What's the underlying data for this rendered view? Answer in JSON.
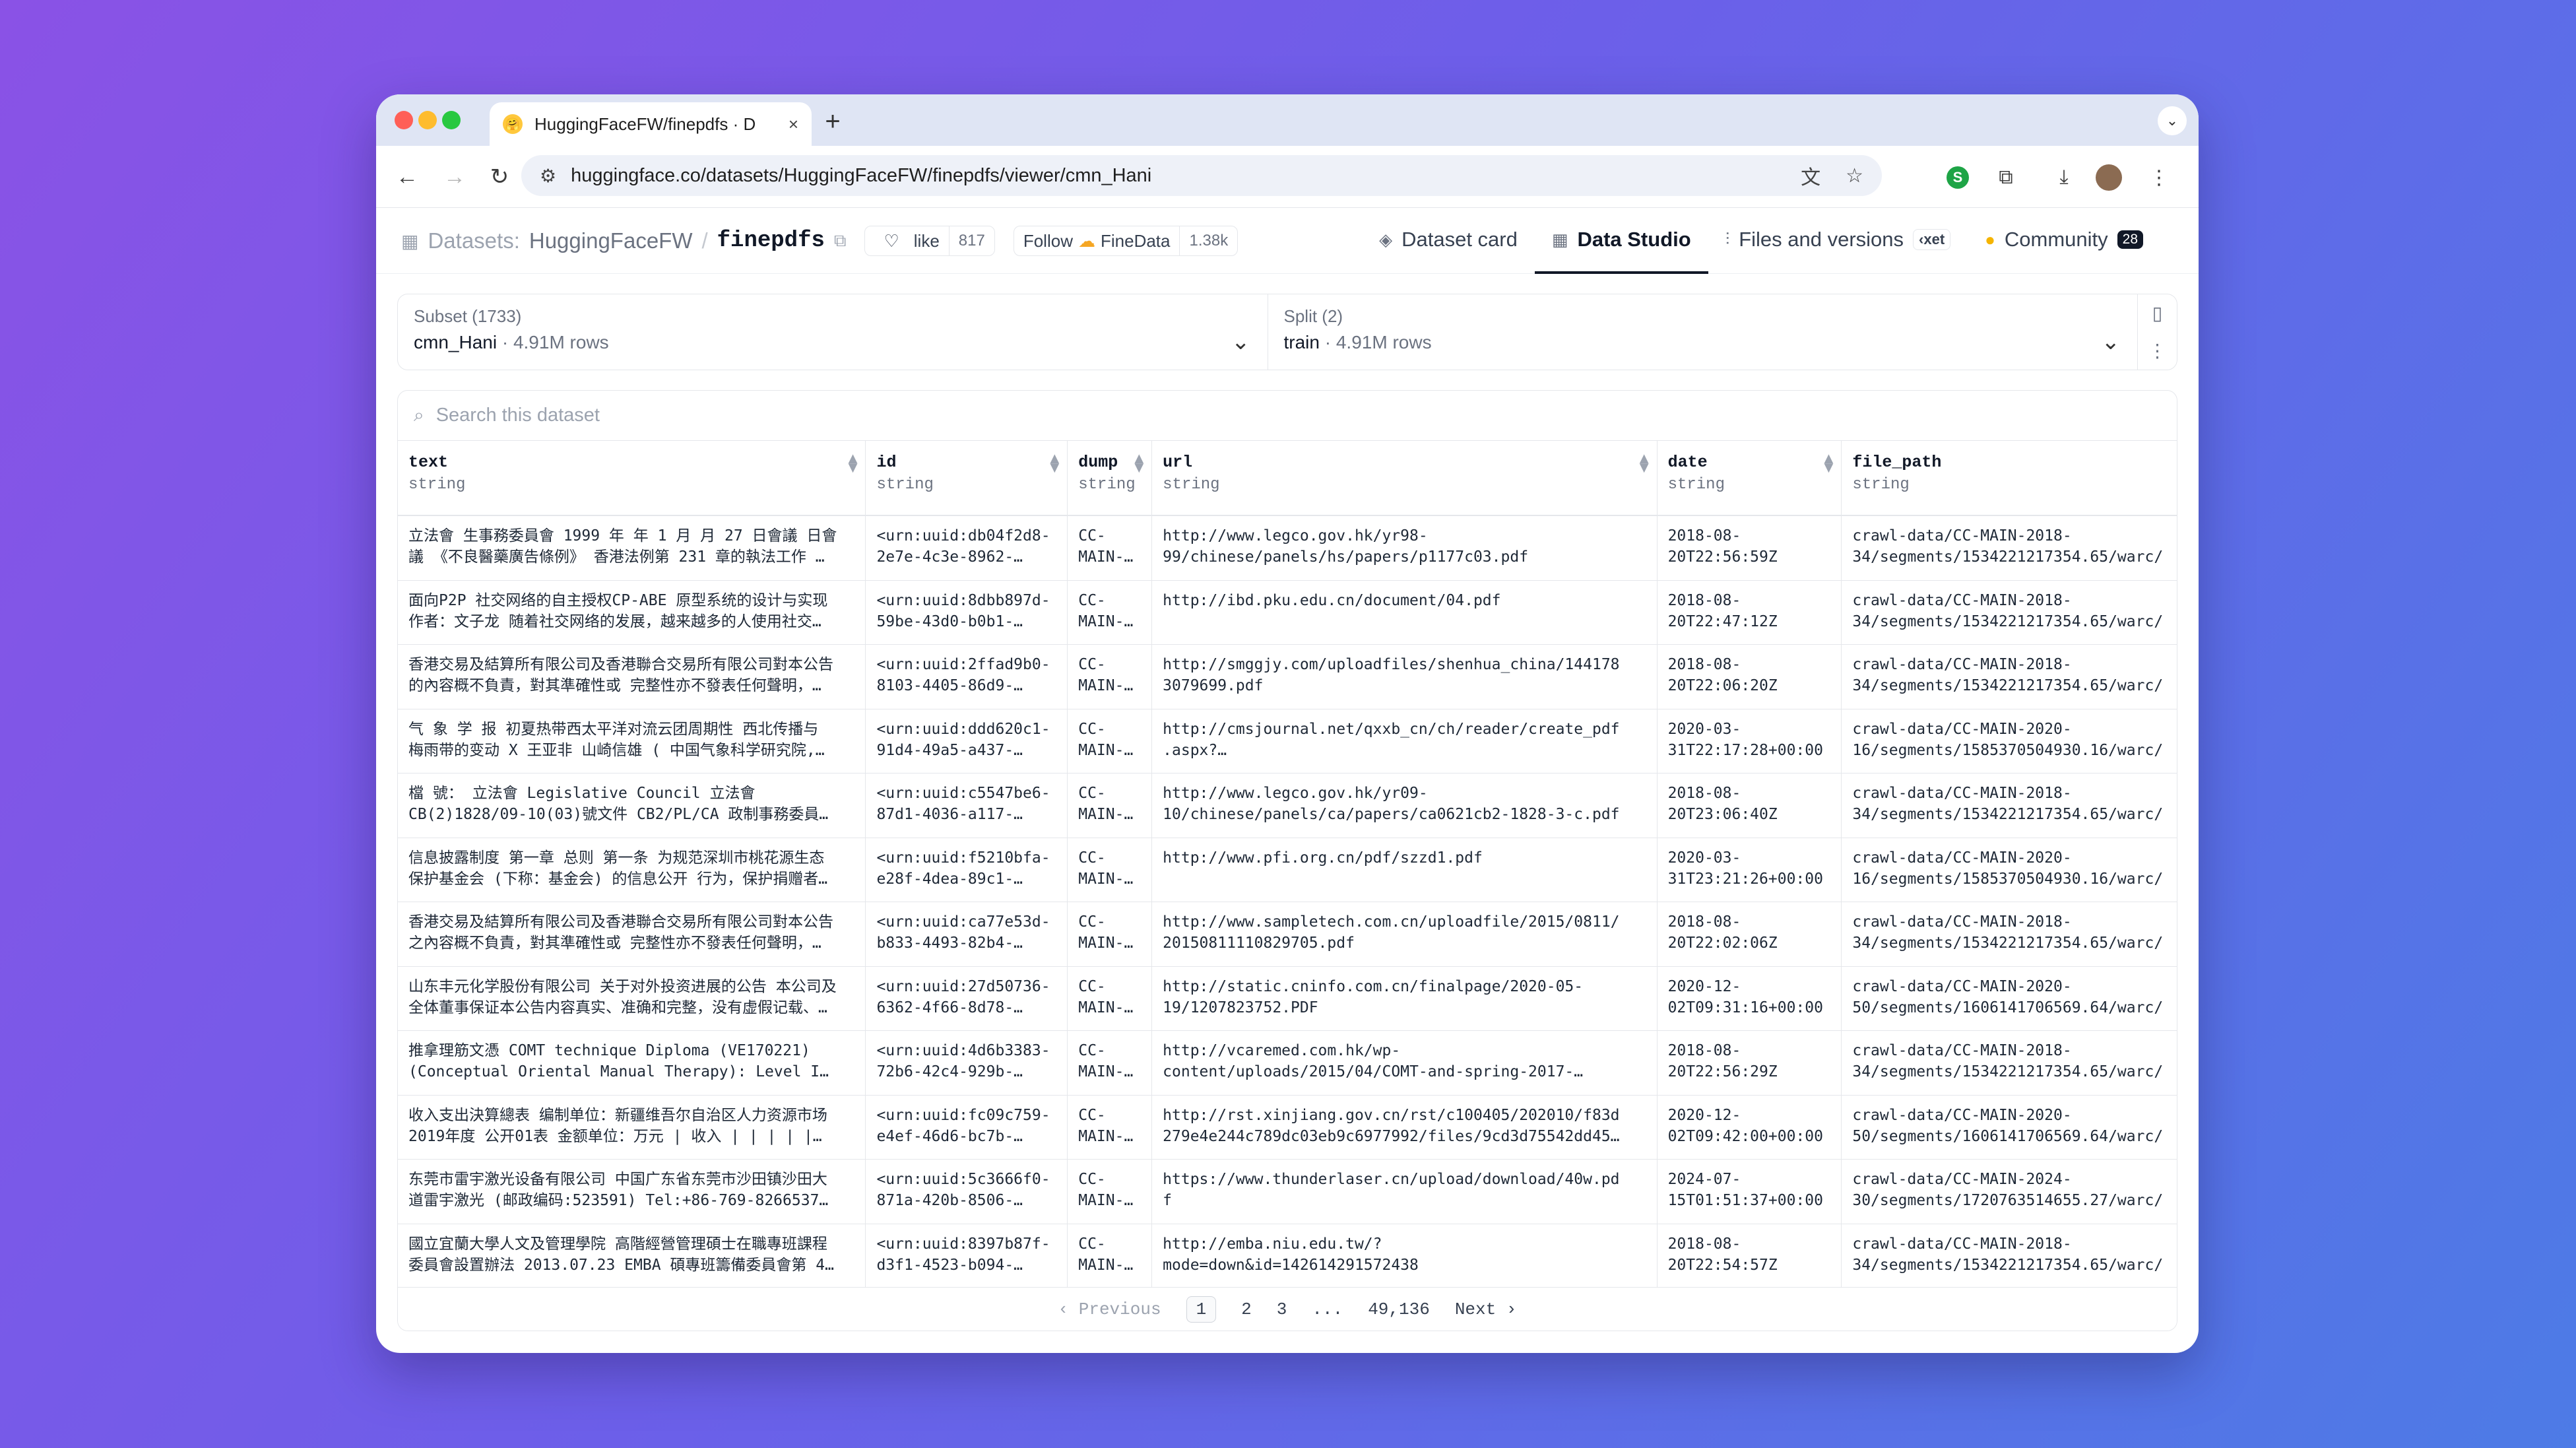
{
  "browser": {
    "tab_title": "HuggingFaceFW/finepdfs · D",
    "tab_favicon": "🤗",
    "close_glyph": "×",
    "newtab_glyph": "+",
    "url": "huggingface.co/datasets/HuggingFaceFW/finepdfs/viewer/cmn_Hani",
    "extension_letter": "S"
  },
  "header": {
    "datasets_label": "Datasets:",
    "org_name": "HuggingFaceFW",
    "separator": "/",
    "repo_name": "finepdfs",
    "like_label": "like",
    "like_count": "817",
    "follow_label": "Follow",
    "follow_org": "FineData",
    "follow_count": "1.38k",
    "tabs": {
      "dataset_card": "Dataset card",
      "data_studio": "Data Studio",
      "files": "Files and versions",
      "xet": "xet",
      "community": "Community",
      "community_count": "28"
    }
  },
  "selector": {
    "subset_label": "Subset (1733)",
    "subset_value": "cmn_Hani",
    "subset_rows": "4.91M rows",
    "split_label": "Split (2)",
    "split_value": "train",
    "split_rows": "4.91M rows",
    "dot": "·"
  },
  "search": {
    "placeholder": "Search this dataset"
  },
  "columns": [
    {
      "name": "text",
      "type": "string"
    },
    {
      "name": "id",
      "type": "string"
    },
    {
      "name": "dump",
      "type": "string"
    },
    {
      "name": "url",
      "type": "string"
    },
    {
      "name": "date",
      "type": "string"
    },
    {
      "name": "file_path",
      "type": "string"
    }
  ],
  "rows": [
    {
      "text": [
        "立法會 生事務委員會 1999 年 年 1 月 月 27 日會議 日會",
        "議 《不良醫藥廣告條例》 香港法例第 231 章的執法工作 …"
      ],
      "id": [
        "<urn:uuid:db04f2d8-",
        "2e7e-4c3e-8962-…"
      ],
      "dump": [
        "CC-",
        "MAIN-…"
      ],
      "url": [
        "http://www.legco.gov.hk/yr98-",
        "99/chinese/panels/hs/papers/p1177c03.pdf"
      ],
      "date": [
        "2018-08-",
        "20T22:56:59Z"
      ],
      "fp": [
        "crawl-data/CC-MAIN-2018-",
        "34/segments/1534221217354.65/warc/"
      ]
    },
    {
      "text": [
        "面向P2P 社交网络的自主授权CP-ABE 原型系统的设计与实现",
        "作者：文子龙 随着社交网络的发展，越来越多的人使用社交…"
      ],
      "id": [
        "<urn:uuid:8dbb897d-",
        "59be-43d0-b0b1-…"
      ],
      "dump": [
        "CC-",
        "MAIN-…"
      ],
      "url": [
        "http://ibd.pku.edu.cn/document/04.pdf",
        ""
      ],
      "date": [
        "2018-08-",
        "20T22:47:12Z"
      ],
      "fp": [
        "crawl-data/CC-MAIN-2018-",
        "34/segments/1534221217354.65/warc/"
      ]
    },
    {
      "text": [
        "香港交易及結算所有限公司及香港聯合交易所有限公司對本公告",
        "的內容概不負責，對其準確性或 完整性亦不發表任何聲明，…"
      ],
      "id": [
        "<urn:uuid:2ffad9b0-",
        "8103-4405-86d9-…"
      ],
      "dump": [
        "CC-",
        "MAIN-…"
      ],
      "url": [
        "http://smggjy.com/uploadfiles/shenhua_china/144178",
        "3079699.pdf"
      ],
      "date": [
        "2018-08-",
        "20T22:06:20Z"
      ],
      "fp": [
        "crawl-data/CC-MAIN-2018-",
        "34/segments/1534221217354.65/warc/"
      ]
    },
    {
      "text": [
        "气 象 学 报 初夏热带西太平洋对流云团周期性 西北传播与",
        "梅雨带的变动 X 王亚非 山崎信雄 ( 中国气象科学研究院,…"
      ],
      "id": [
        "<urn:uuid:ddd620c1-",
        "91d4-49a5-a437-…"
      ],
      "dump": [
        "CC-",
        "MAIN-…"
      ],
      "url": [
        "http://cmsjournal.net/qxxb_cn/ch/reader/create_pdf",
        ".aspx?…"
      ],
      "date": [
        "2020-03-",
        "31T22:17:28+00:00"
      ],
      "fp": [
        "crawl-data/CC-MAIN-2020-",
        "16/segments/1585370504930.16/warc/"
      ]
    },
    {
      "text": [
        "檔 號： 立法會 Legislative Council 立法會",
        "CB(2)1828/09-10(03)號文件 CB2/PL/CA 政制事務委員…"
      ],
      "id": [
        "<urn:uuid:c5547be6-",
        "87d1-4036-a117-…"
      ],
      "dump": [
        "CC-",
        "MAIN-…"
      ],
      "url": [
        "http://www.legco.gov.hk/yr09-",
        "10/chinese/panels/ca/papers/ca0621cb2-1828-3-c.pdf"
      ],
      "date": [
        "2018-08-",
        "20T23:06:40Z"
      ],
      "fp": [
        "crawl-data/CC-MAIN-2018-",
        "34/segments/1534221217354.65/warc/"
      ]
    },
    {
      "text": [
        "信息披露制度 第一章 总则 第一条 为规范深圳市桃花源生态",
        "保护基金会 (下称：基金会) 的信息公开 行为，保护捐赠者…"
      ],
      "id": [
        "<urn:uuid:f5210bfa-",
        "e28f-4dea-89c1-…"
      ],
      "dump": [
        "CC-",
        "MAIN-…"
      ],
      "url": [
        "http://www.pfi.org.cn/pdf/szzd1.pdf",
        ""
      ],
      "date": [
        "2020-03-",
        "31T23:21:26+00:00"
      ],
      "fp": [
        "crawl-data/CC-MAIN-2020-",
        "16/segments/1585370504930.16/warc/"
      ]
    },
    {
      "text": [
        "香港交易及結算所有限公司及香港聯合交易所有限公司對本公告",
        "之內容概不負責，對其準確性或 完整性亦不發表任何聲明，…"
      ],
      "id": [
        "<urn:uuid:ca77e53d-",
        "b833-4493-82b4-…"
      ],
      "dump": [
        "CC-",
        "MAIN-…"
      ],
      "url": [
        "http://www.sampletech.com.cn/uploadfile/2015/0811/",
        "20150811110829705.pdf"
      ],
      "date": [
        "2018-08-",
        "20T22:02:06Z"
      ],
      "fp": [
        "crawl-data/CC-MAIN-2018-",
        "34/segments/1534221217354.65/warc/"
      ]
    },
    {
      "text": [
        "山东丰元化学股份有限公司 关于对外投资进展的公告 本公司及",
        "全体董事保证本公告内容真实、准确和完整，没有虚假记载、…"
      ],
      "id": [
        "<urn:uuid:27d50736-",
        "6362-4f66-8d78-…"
      ],
      "dump": [
        "CC-",
        "MAIN-…"
      ],
      "url": [
        "http://static.cninfo.com.cn/finalpage/2020-05-",
        "19/1207823752.PDF"
      ],
      "date": [
        "2020-12-",
        "02T09:31:16+00:00"
      ],
      "fp": [
        "crawl-data/CC-MAIN-2020-",
        "50/segments/1606141706569.64/warc/"
      ]
    },
    {
      "text": [
        "推拿理筋文憑 COMT technique Diploma (VE170221)",
        "(Conceptual Oriental Manual Therapy): Level I…"
      ],
      "id": [
        "<urn:uuid:4d6b3383-",
        "72b6-42c4-929b-…"
      ],
      "dump": [
        "CC-",
        "MAIN-…"
      ],
      "url": [
        "http://vcaremed.com.hk/wp-",
        "content/uploads/2015/04/COMT-and-spring-2017-…"
      ],
      "date": [
        "2018-08-",
        "20T22:56:29Z"
      ],
      "fp": [
        "crawl-data/CC-MAIN-2018-",
        "34/segments/1534221217354.65/warc/"
      ]
    },
    {
      "text": [
        "收入支出決算總表 编制单位：新疆维吾尔自治区人力资源市场",
        "2019年度 公开01表 金额单位：万元 | 收入 | | | | |…"
      ],
      "id": [
        "<urn:uuid:fc09c759-",
        "e4ef-46d6-bc7b-…"
      ],
      "dump": [
        "CC-",
        "MAIN-…"
      ],
      "url": [
        "http://rst.xinjiang.gov.cn/rst/c100405/202010/f83d",
        "279e4e244c789dc03eb9c6977992/files/9cd3d75542dd45…"
      ],
      "date": [
        "2020-12-",
        "02T09:42:00+00:00"
      ],
      "fp": [
        "crawl-data/CC-MAIN-2020-",
        "50/segments/1606141706569.64/warc/"
      ]
    },
    {
      "text": [
        "东莞市雷宇激光设备有限公司 中国广东省东莞市沙田镇沙田大",
        "道雷宇激光 (邮政编码:523591) Tel:+86-769-8266537…"
      ],
      "id": [
        "<urn:uuid:5c3666f0-",
        "871a-420b-8506-…"
      ],
      "dump": [
        "CC-",
        "MAIN-…"
      ],
      "url": [
        "https://www.thunderlaser.cn/upload/download/40w.pd",
        "f"
      ],
      "date": [
        "2024-07-",
        "15T01:51:37+00:00"
      ],
      "fp": [
        "crawl-data/CC-MAIN-2024-",
        "30/segments/1720763514655.27/warc/"
      ]
    },
    {
      "text": [
        "國立宜蘭大學人文及管理學院 高階經營管理碩士在職專班課程",
        "委員會設置辦法 2013.07.23 EMBA 碩專班籌備委員會第 4…"
      ],
      "id": [
        "<urn:uuid:8397b87f-",
        "d3f1-4523-b094-…"
      ],
      "dump": [
        "CC-",
        "MAIN-…"
      ],
      "url": [
        "http://emba.niu.edu.tw/?",
        "mode=down&id=142614291572438"
      ],
      "date": [
        "2018-08-",
        "20T22:54:57Z"
      ],
      "fp": [
        "crawl-data/CC-MAIN-2018-",
        "34/segments/1534221217354.65/warc/"
      ]
    }
  ],
  "pager": {
    "previous": "‹ Previous",
    "pages": [
      "1",
      "2",
      "3"
    ],
    "ellipsis": "...",
    "last": "49,136",
    "next": "Next ›"
  }
}
